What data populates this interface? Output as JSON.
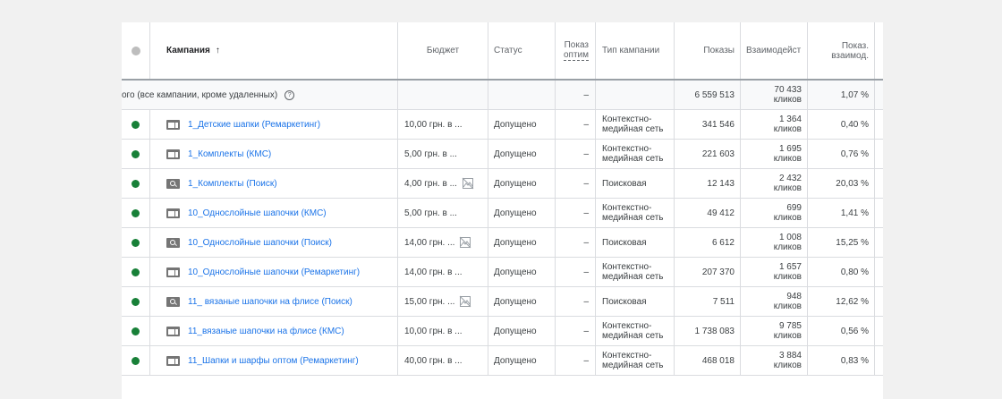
{
  "header": {
    "campaign": "Кампания",
    "sort_arrow": "↑",
    "budget": "Бюджет",
    "status": "Статус",
    "optimization_line1": "Показ",
    "optimization_line2": "оптим",
    "type": "Тип кампании",
    "impressions": "Показы",
    "interactions": "Взаимодейст",
    "rate_line1": "Показ.",
    "rate_line2": "взаимод."
  },
  "total": {
    "label": "ого (все кампании, кроме удаленных)",
    "help": "?",
    "optimization": "–",
    "impressions": "6 559 513",
    "interactions": "70 433",
    "interactions_unit": "кликов",
    "rate": "1,07 %"
  },
  "rows": [
    {
      "icon": "display",
      "name": "1_Детские шапки (Ремаркетинг)",
      "budget": "10,00 грн. в ...",
      "no_image": false,
      "status": "Допущено",
      "optimization": "–",
      "type_line1": "Контекстно-",
      "type_line2": "медийная сеть",
      "impressions": "341 546",
      "interactions": "1 364",
      "interactions_unit": "кликов",
      "rate": "0,40 %"
    },
    {
      "icon": "display",
      "name": "1_Комплекты (КМС)",
      "budget": "5,00 грн. в ...",
      "no_image": false,
      "status": "Допущено",
      "optimization": "–",
      "type_line1": "Контекстно-",
      "type_line2": "медийная сеть",
      "impressions": "221 603",
      "interactions": "1 695",
      "interactions_unit": "кликов",
      "rate": "0,76 %"
    },
    {
      "icon": "search",
      "name": "1_Комплекты (Поиск)",
      "budget": "4,00 грн. в ...",
      "no_image": true,
      "status": "Допущено",
      "optimization": "–",
      "type_line1": "Поисковая",
      "type_line2": "",
      "impressions": "12 143",
      "interactions": "2 432",
      "interactions_unit": "кликов",
      "rate": "20,03 %"
    },
    {
      "icon": "display",
      "name": "10_Однослойные шапочки (КМС)",
      "budget": "5,00 грн. в ...",
      "no_image": false,
      "status": "Допущено",
      "optimization": "–",
      "type_line1": "Контекстно-",
      "type_line2": "медийная сеть",
      "impressions": "49 412",
      "interactions": "699",
      "interactions_unit": "кликов",
      "rate": "1,41 %"
    },
    {
      "icon": "search",
      "name": "10_Однослойные шапочки (Поиск)",
      "budget": "14,00 грн. ...",
      "no_image": true,
      "status": "Допущено",
      "optimization": "–",
      "type_line1": "Поисковая",
      "type_line2": "",
      "impressions": "6 612",
      "interactions": "1 008",
      "interactions_unit": "кликов",
      "rate": "15,25 %"
    },
    {
      "icon": "display",
      "name": "10_Однослойные шапочки (Ремаркетинг)",
      "budget": "14,00 грн. в ...",
      "no_image": false,
      "status": "Допущено",
      "optimization": "–",
      "type_line1": "Контекстно-",
      "type_line2": "медийная сеть",
      "impressions": "207 370",
      "interactions": "1 657",
      "interactions_unit": "кликов",
      "rate": "0,80 %"
    },
    {
      "icon": "search",
      "name": "11_ вязаные шапочки на флисе (Поиск)",
      "budget": "15,00 грн. ...",
      "no_image": true,
      "status": "Допущено",
      "optimization": "–",
      "type_line1": "Поисковая",
      "type_line2": "",
      "impressions": "7 511",
      "interactions": "948",
      "interactions_unit": "кликов",
      "rate": "12,62 %"
    },
    {
      "icon": "display",
      "name": "11_вязаные шапочки на флисе (КМС)",
      "budget": "10,00 грн. в ...",
      "no_image": false,
      "status": "Допущено",
      "optimization": "–",
      "type_line1": "Контекстно-",
      "type_line2": "медийная сеть",
      "impressions": "1 738 083",
      "interactions": "9 785",
      "interactions_unit": "кликов",
      "rate": "0,56 %"
    },
    {
      "icon": "display",
      "name": "11_Шапки и шарфы оптом (Ремаркетинг)",
      "budget": "40,00 грн. в ...",
      "no_image": false,
      "status": "Допущено",
      "optimization": "–",
      "type_line1": "Контекстно-",
      "type_line2": "медийная сеть",
      "impressions": "468 018",
      "interactions": "3 884",
      "interactions_unit": "кликов",
      "rate": "0,83 %"
    }
  ],
  "colors": {
    "status_enabled": "#188038",
    "link": "#1a73e8",
    "header_dot": "#bdbdbd"
  },
  "icons": {
    "display_campaign": "display-campaign-icon",
    "search_campaign": "search-campaign-icon",
    "no_image": "no-image-icon",
    "help": "help-icon",
    "sort": "sort-arrow-up-icon"
  }
}
